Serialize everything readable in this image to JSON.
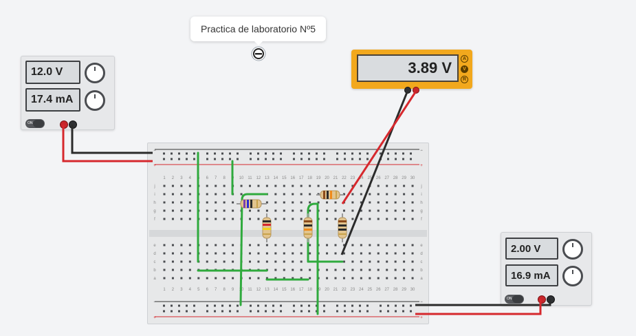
{
  "note": {
    "text": "Practica de laboratorio Nº5"
  },
  "multimeter": {
    "reading": "3.89 V",
    "modes": [
      "A",
      "V",
      "R"
    ],
    "active_mode": "V"
  },
  "power_supply_left": {
    "voltage": "12.0 V",
    "current": "17.4 mA",
    "switch_label": "ON"
  },
  "power_supply_right": {
    "voltage": "2.00 V",
    "current": "16.9 mA",
    "switch_label": "ON"
  },
  "breadboard": {
    "columns": [
      "1",
      "2",
      "3",
      "4",
      "5",
      "6",
      "7",
      "8",
      "9",
      "10",
      "11",
      "12",
      "13",
      "14",
      "15",
      "16",
      "17",
      "18",
      "19",
      "20",
      "21",
      "22",
      "23",
      "24",
      "25",
      "26",
      "27",
      "28",
      "29",
      "30"
    ],
    "rows_top": [
      "j",
      "i",
      "h",
      "g",
      "f"
    ],
    "rows_bottom": [
      "e",
      "d",
      "c",
      "b",
      "a"
    ],
    "rail_minus": "−",
    "rail_plus": "+"
  },
  "colors": {
    "wire_green": "#2faa3d",
    "wire_red": "#d6282d",
    "wire_black": "#2b2b2b",
    "meter_body": "#f2a81d"
  }
}
